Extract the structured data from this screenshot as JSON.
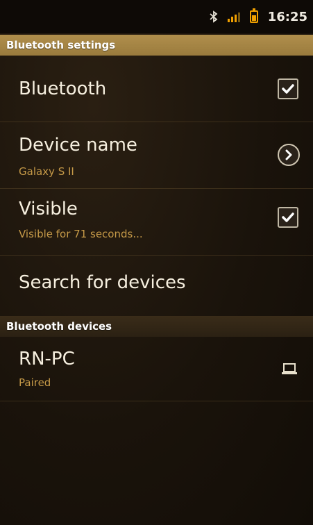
{
  "status_bar": {
    "time": "16:25",
    "icons": [
      "bluetooth-icon",
      "signal-icon",
      "battery-icon"
    ]
  },
  "settings": {
    "header": "Bluetooth settings",
    "items": [
      {
        "title": "Bluetooth",
        "subtitle": "",
        "control": "checkbox",
        "checked": true
      },
      {
        "title": "Device name",
        "subtitle": "Galaxy S II",
        "control": "chevron-right-icon"
      },
      {
        "title": "Visible",
        "subtitle": "Visible for 71 seconds...",
        "control": "checkbox",
        "checked": true
      },
      {
        "title": "Search for devices",
        "subtitle": ""
      }
    ]
  },
  "devices": {
    "header": "Bluetooth devices",
    "items": [
      {
        "title": "RN-PC",
        "subtitle": "Paired",
        "icon": "laptop-icon"
      }
    ]
  },
  "colors": {
    "accent": "#f0a000",
    "header": "#a9884a",
    "subtitle": "#c69a48",
    "background": "#1a130b"
  }
}
